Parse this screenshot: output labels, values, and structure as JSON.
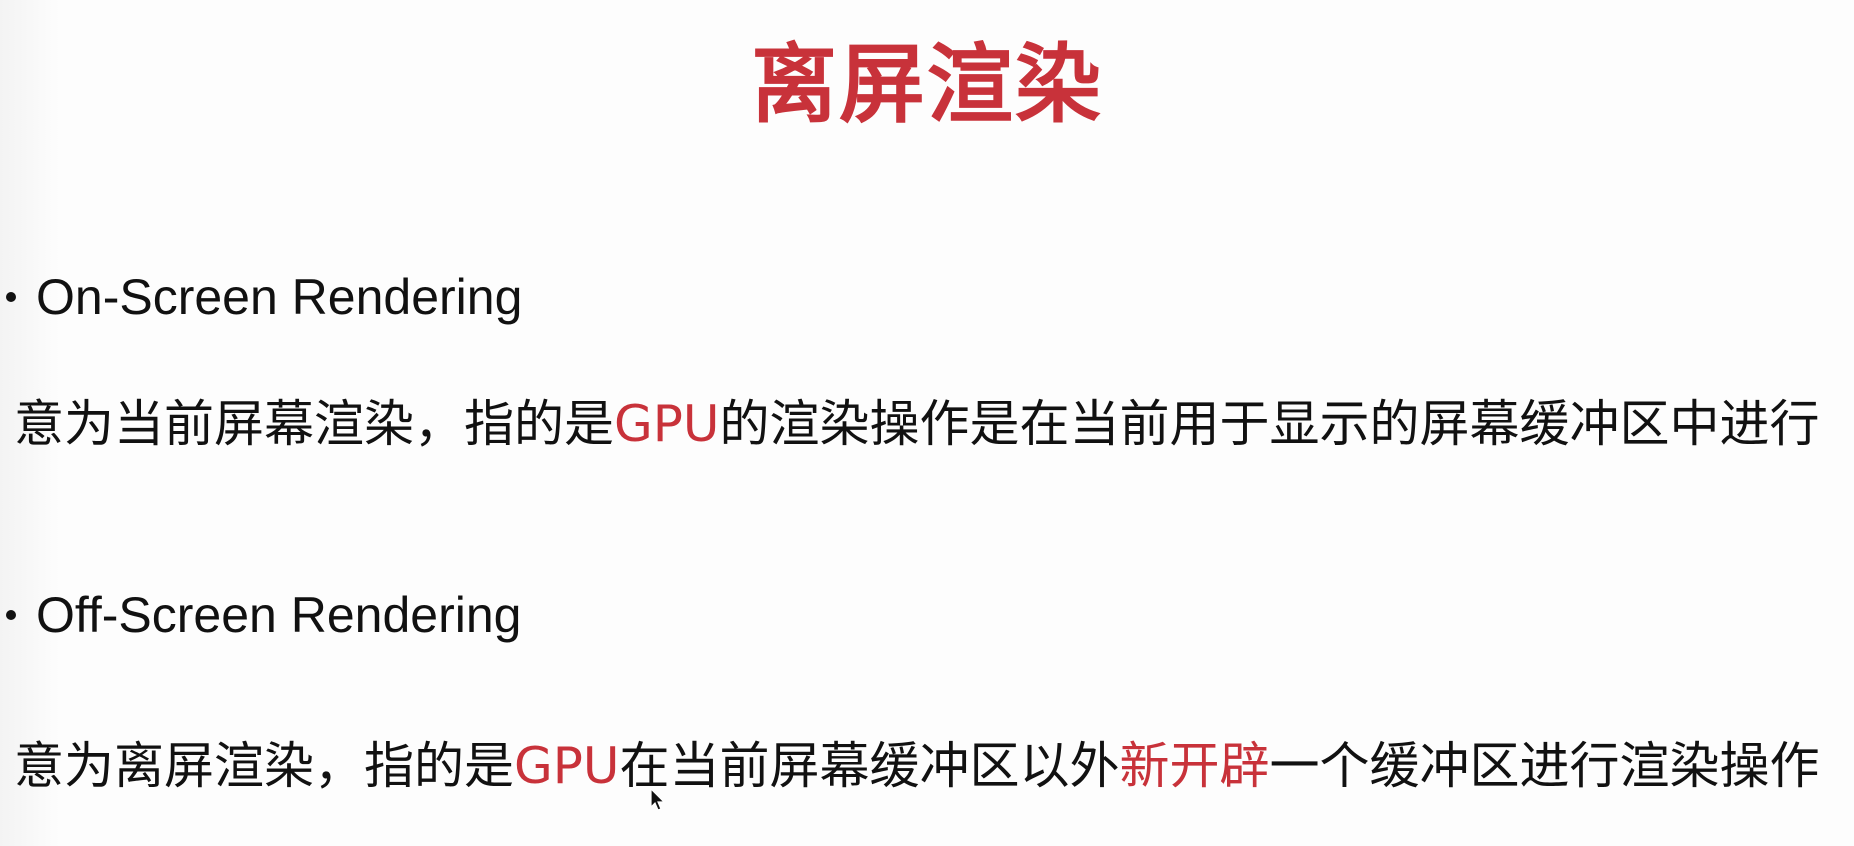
{
  "slide": {
    "title": "离屏渲染",
    "accent_color": "#c8323a",
    "items": [
      {
        "heading": "On-Screen Rendering",
        "desc": {
          "part1": "意为当前屏幕渲染，指的是",
          "highlight1": "GPU",
          "part2": "的渲染操作是在当前用于显示的屏幕缓冲区中进行"
        }
      },
      {
        "heading": "Off-Screen Rendering",
        "desc": {
          "part1": "意为离屏渲染，指的是",
          "highlight1": "GPU",
          "part2": "在当前屏幕缓冲区以外",
          "highlight2": "新开辟",
          "part3": "一个缓冲区进行渲染操作"
        }
      }
    ]
  },
  "icons": {
    "cursor": "mouse-pointer-icon"
  }
}
